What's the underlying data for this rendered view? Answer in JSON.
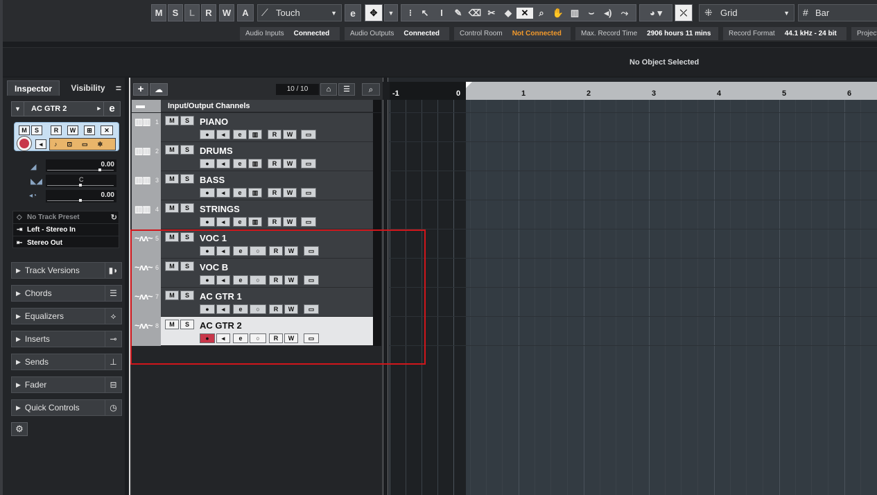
{
  "toolbar": {
    "buttons": [
      "M",
      "S",
      "L",
      "R",
      "W",
      "A"
    ],
    "automation_mode": "Touch",
    "snap_type": "Grid",
    "grid_type": "Bar",
    "tools": [
      "object-selection-icon",
      "range-selection-icon",
      "draw-icon",
      "erase-icon",
      "split-icon",
      "glue-icon",
      "mute-icon",
      "zoom-icon",
      "hand-icon",
      "comp-icon",
      "line-icon",
      "play-icon",
      "color-icon",
      "snap-icon",
      "grid-icon"
    ]
  },
  "status": {
    "audio_inputs": {
      "label": "Audio Inputs",
      "value": "Connected"
    },
    "audio_outputs": {
      "label": "Audio Outputs",
      "value": "Connected"
    },
    "control_room": {
      "label": "Control Room",
      "value": "Not Connected"
    },
    "max_record_time": {
      "label": "Max. Record Time",
      "value": "2906 hours 11 mins"
    },
    "record_format": {
      "label": "Record Format",
      "value": "44.1 kHz - 24 bit"
    },
    "project_label": "Project"
  },
  "info_line": "No Object Selected",
  "inspector": {
    "tab_inspector": "Inspector",
    "tab_visibility": "Visibility",
    "menu_glyph": "=",
    "track_name": "AC GTR 2",
    "volume": "0.00",
    "pan": "C",
    "delay": "0.00",
    "preset": "No Track Preset",
    "input": "Left - Stereo In",
    "output": "Stereo Out",
    "sections": [
      "Track Versions",
      "Chords",
      "Equalizers",
      "Inserts",
      "Sends",
      "Fader",
      "Quick Controls"
    ]
  },
  "tracklist": {
    "count": "10 / 10",
    "folder_name": "Input/Output Channels",
    "tracks": [
      {
        "num": "1",
        "name": "PIANO",
        "type": "instrument"
      },
      {
        "num": "2",
        "name": "DRUMS",
        "type": "instrument"
      },
      {
        "num": "3",
        "name": "BASS",
        "type": "instrument"
      },
      {
        "num": "4",
        "name": "STRINGS",
        "type": "instrument"
      },
      {
        "num": "5",
        "name": "VOC 1",
        "type": "audio"
      },
      {
        "num": "6",
        "name": "VOC B",
        "type": "audio"
      },
      {
        "num": "7",
        "name": "AC GTR 1",
        "type": "audio"
      },
      {
        "num": "8",
        "name": "AC GTR 2",
        "type": "audio",
        "selected": true
      }
    ],
    "btn_m": "M",
    "btn_s": "S",
    "btn_r": "R",
    "btn_w": "W"
  },
  "ruler": {
    "labels": [
      "-1",
      "0",
      "1",
      "2",
      "3",
      "4",
      "5",
      "6"
    ]
  },
  "colors": {
    "record_active": "#c8374a",
    "warning": "#f39a2b",
    "highlight_box": "#d1161b",
    "selected_track": "#e5e6e8"
  }
}
